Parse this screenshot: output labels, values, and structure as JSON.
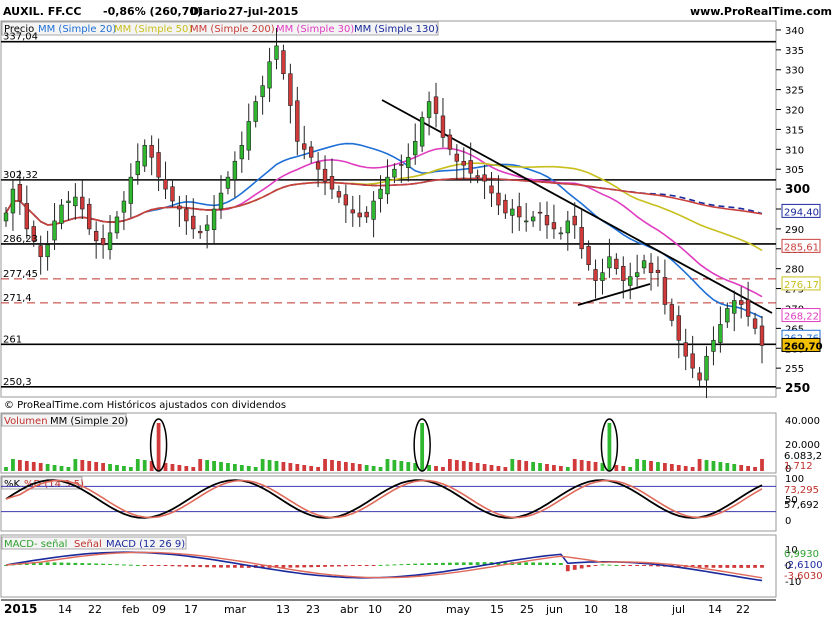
{
  "header": {
    "title": "AUXIL. FF.CC",
    "change": "-0,86% (260,70)",
    "period": "Diario",
    "date": "27-jul-2015",
    "site": "www.ProRealTime.com"
  },
  "price_panel": {
    "label": "Precio",
    "legend": [
      {
        "text": "MM (Simple 20)",
        "color": "#1f6fd6"
      },
      {
        "text": "MM (Simple 50)",
        "color": "#c8bf1c"
      },
      {
        "text": "MM (Simple 200)",
        "color": "#c8403c"
      },
      {
        "text": "MM (Simple 30)",
        "color": "#e03cc0"
      },
      {
        "text": "MM (Simple 130)",
        "color": "#1a2a9c"
      }
    ],
    "y_ticks": [
      "340",
      "335",
      "330",
      "325",
      "320",
      "315",
      "310",
      "305",
      "300",
      "295",
      "290",
      "285",
      "280",
      "275",
      "270",
      "265",
      "260",
      "255",
      "250"
    ],
    "left_levels": [
      "337,04",
      "302,32",
      "286,23",
      "277,45",
      "271,4",
      "261",
      "250,3"
    ],
    "right_tags": [
      {
        "text": "294,40",
        "color": "#1a2a9c"
      },
      {
        "text": "285,61",
        "color": "#c8403c"
      },
      {
        "text": "276,17",
        "color": "#c8bf1c"
      },
      {
        "text": "268,22",
        "color": "#e03cc0"
      },
      {
        "text": "262,76",
        "color": "#1f6fd6"
      },
      {
        "text": "260,70",
        "color": "#000000"
      }
    ],
    "copyright": "© ProRealTime.com Históricos ajustados con dividendos"
  },
  "volume_panel": {
    "labels": [
      "Volumen",
      "MM (Simple 20)"
    ],
    "ticks": [
      "40.000",
      "20.000",
      "0"
    ],
    "tags": [
      "6.083,2",
      "1.712"
    ]
  },
  "stoch_panel": {
    "labels": [
      "%K",
      "%D (14 3 5)"
    ],
    "ticks": [
      "100",
      "50",
      "0"
    ],
    "tags": [
      "73,295",
      "57,692"
    ]
  },
  "macd_panel": {
    "labels": [
      "MACD- señal",
      "Señal",
      "MACD (12 26 9)"
    ],
    "ticks": [
      "10",
      "0",
      "-10"
    ],
    "tags": [
      "0,9930",
      "-2,6100",
      "-3,6030"
    ]
  },
  "x_axis": {
    "labels": [
      "2015",
      "14",
      "22",
      "feb",
      "09",
      "17",
      "mar",
      "13",
      "23",
      "abr",
      "10",
      "20",
      "may",
      "15",
      "25",
      "jun",
      "10",
      "18",
      "jul",
      "14",
      "22"
    ]
  },
  "chart_data": {
    "type": "candlestick",
    "title": "AUXIL. FF.CC",
    "ylim": [
      248,
      342
    ],
    "horizontal_levels": [
      337.04,
      302.32,
      286.23,
      261,
      250.3
    ],
    "dashed_levels": [
      277.45,
      271.4
    ],
    "last": {
      "close": 260.7,
      "sma20": 262.76,
      "sma30": 268.22,
      "sma50": 276.17,
      "sma130": 294.4,
      "sma200": 285.61
    },
    "volume_last": {
      "sma20": 6083.2,
      "volume": 1712
    },
    "stochastic_last": {
      "k": 73.295,
      "d": 57.692
    },
    "macd_last": {
      "hist": 0.993,
      "macd": -2.61,
      "signal": -3.603
    },
    "close_series": [
      294,
      300,
      297,
      290,
      287,
      283,
      286,
      292,
      296,
      297,
      298,
      295,
      290,
      287,
      286,
      289,
      293,
      297,
      303,
      307,
      311,
      308,
      303,
      300,
      297,
      295,
      292,
      290,
      289,
      291,
      295,
      299,
      303,
      307,
      311,
      317,
      322,
      326,
      332,
      336,
      329,
      321,
      312,
      310,
      308,
      305,
      302,
      300,
      298,
      296,
      294,
      293,
      293,
      297,
      300,
      303,
      305,
      306,
      308,
      312,
      318,
      322,
      319,
      313,
      310,
      307,
      306,
      304,
      303,
      302,
      299,
      296,
      294,
      295,
      293,
      292,
      293,
      294,
      291,
      290,
      289,
      292,
      291,
      285,
      281,
      277,
      279,
      283,
      280,
      277,
      278,
      279,
      282,
      279,
      279,
      271,
      267,
      262,
      258,
      255,
      252,
      258,
      262,
      266,
      270,
      272,
      271,
      268,
      265,
      260.7
    ]
  }
}
